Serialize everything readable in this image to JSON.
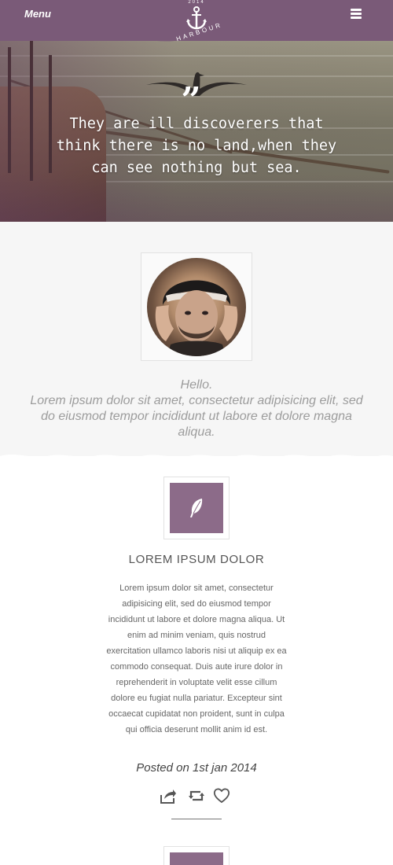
{
  "header": {
    "menu_label": "Menu",
    "logo_year": "2014",
    "logo_name": "HARBOUR",
    "hamburger_icon": "hamburger-icon",
    "brand_color": "#7a5a78"
  },
  "hero": {
    "quote_icon": "quote-icon",
    "quote": "They are ill discoverers that think there is no land,when they can see nothing but sea."
  },
  "intro": {
    "hello": "Hello.",
    "text": "Lorem ipsum dolor sit amet, consectetur adipisicing elit, sed do eiusmod tempor incididunt ut labore et dolore magna aliqua."
  },
  "post": {
    "icon": "feather-icon",
    "title": "LOREM IPSUM DOLOR",
    "body": "Lorem ipsum dolor sit amet, consectetur adipisicing elit, sed do eiusmod tempor incididunt ut labore et dolore magna aliqua. Ut enim ad minim veniam, quis nostrud exercitation ullamco laboris nisi ut aliquip ex ea commodo consequat. Duis aute irure dolor in reprehenderit in voluptate velit esse cillum dolore eu fugiat nulla pariatur. Excepteur sint occaecat cupidatat non proident, sunt in culpa qui officia deserunt mollit anim id est.",
    "date": "Posted on 1st jan 2014",
    "actions": [
      "share-icon",
      "retweet-icon",
      "heart-icon"
    ],
    "accent_color": "#8c6b89"
  }
}
